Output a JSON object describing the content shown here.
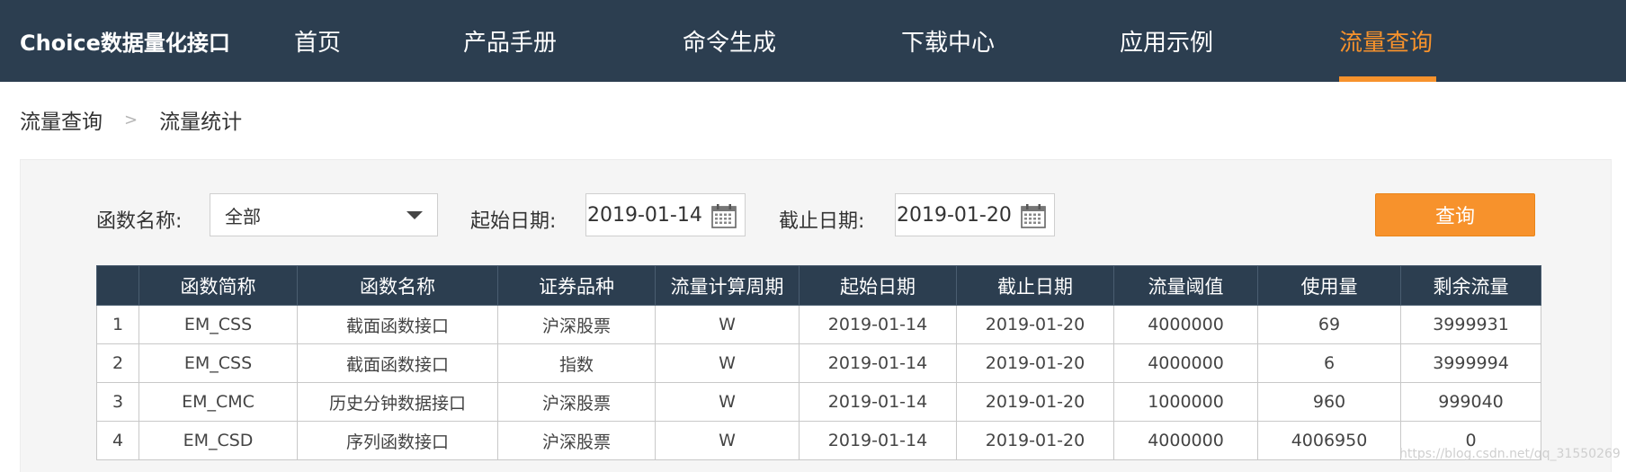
{
  "nav": {
    "brand": "Choice数据量化接口",
    "items": [
      {
        "label": "首页"
      },
      {
        "label": "产品手册"
      },
      {
        "label": "命令生成"
      },
      {
        "label": "下载中心"
      },
      {
        "label": "应用示例"
      },
      {
        "label": "流量查询",
        "active": true
      }
    ]
  },
  "breadcrumb": {
    "parent": "流量查询",
    "separator": ">",
    "current": "流量统计"
  },
  "filters": {
    "func_label": "函数名称:",
    "func_value": "全部",
    "start_label": "起始日期:",
    "start_value": "2019-01-14",
    "end_label": "截止日期:",
    "end_value": "2019-01-20",
    "query_label": "查询"
  },
  "table": {
    "headers": [
      "",
      "函数简称",
      "函数名称",
      "证券品种",
      "流量计算周期",
      "起始日期",
      "截止日期",
      "流量阈值",
      "使用量",
      "剩余流量"
    ],
    "rows": [
      [
        "1",
        "EM_CSS",
        "截面函数接口",
        "沪深股票",
        "W",
        "2019-01-14",
        "2019-01-20",
        "4000000",
        "69",
        "3999931"
      ],
      [
        "2",
        "EM_CSS",
        "截面函数接口",
        "指数",
        "W",
        "2019-01-14",
        "2019-01-20",
        "4000000",
        "6",
        "3999994"
      ],
      [
        "3",
        "EM_CMC",
        "历史分钟数据接口",
        "沪深股票",
        "W",
        "2019-01-14",
        "2019-01-20",
        "1000000",
        "960",
        "999040"
      ],
      [
        "4",
        "EM_CSD",
        "序列函数接口",
        "沪深股票",
        "W",
        "2019-01-14",
        "2019-01-20",
        "4000000",
        "4006950",
        "0"
      ]
    ]
  },
  "watermark": "https://blog.csdn.net/qq_31550269",
  "colors": {
    "nav_bg": "#2c3e50",
    "accent": "#f7922c",
    "panel_bg": "#f5f5f5"
  }
}
